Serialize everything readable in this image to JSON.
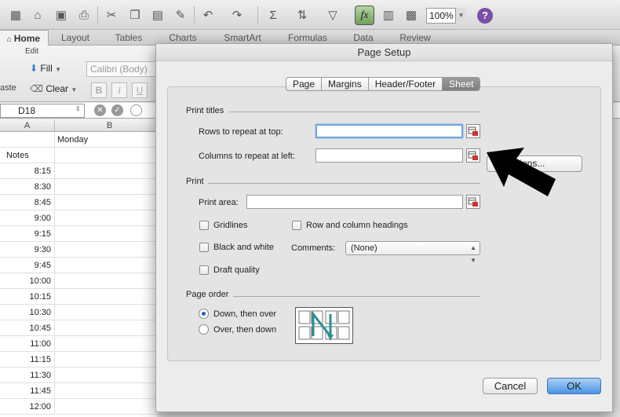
{
  "toolbar": {
    "zoom": "100%",
    "fx_label": "fx",
    "help_label": "?"
  },
  "ribbon_tabs": [
    "Home",
    "Layout",
    "Tables",
    "Charts",
    "SmartArt",
    "Formulas",
    "Data",
    "Review"
  ],
  "ribbon": {
    "group_edit": "Edit",
    "fill_label": "Fill",
    "clear_label": "Clear",
    "font_name": "Calibri (Body)",
    "paste_label": "aste",
    "bold": "B",
    "italic": "I",
    "underline": "U"
  },
  "formula_bar": {
    "name_box": "D18"
  },
  "sheet": {
    "col_a": "A",
    "col_b": "B",
    "b1": "Monday",
    "a2": "Notes",
    "times": [
      "8:15",
      "8:30",
      "8:45",
      "9:00",
      "9:15",
      "9:30",
      "9:45",
      "10:00",
      "10:15",
      "10:30",
      "10:45",
      "11:00",
      "11:15",
      "11:30",
      "11:45",
      "12:00"
    ]
  },
  "dialog": {
    "title": "Page Setup",
    "tabs": [
      "Page",
      "Margins",
      "Header/Footer",
      "Sheet"
    ],
    "selected_tab": "Sheet",
    "print_titles": {
      "heading": "Print titles",
      "rows_label": "Rows to repeat at top:",
      "rows_value": "",
      "cols_label": "Columns to repeat at left:",
      "cols_value": ""
    },
    "print": {
      "heading": "Print",
      "area_label": "Print area:",
      "area_value": "",
      "gridlines": "Gridlines",
      "row_col_headings": "Row and column headings",
      "black_white": "Black and white",
      "comments_label": "Comments:",
      "comments_value": "(None)",
      "draft": "Draft quality"
    },
    "page_order": {
      "heading": "Page order",
      "down_then_over": "Down, then over",
      "over_then_down": "Over, then down",
      "selected": "Down, then over"
    },
    "options_button": "Options...",
    "options_visible": "tions...",
    "cancel_button": "Cancel",
    "ok_button": "OK"
  },
  "colors": {
    "ok_blue": "#4b94e3",
    "focus_ring": "#6fa4dd",
    "fx_green": "#6ea05c"
  }
}
